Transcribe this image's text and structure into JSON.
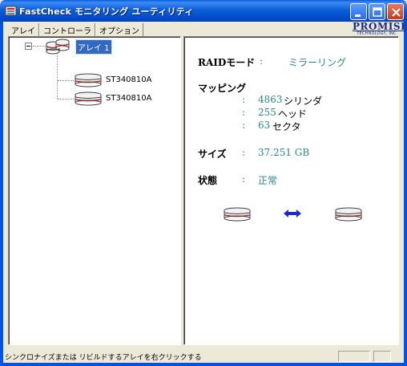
{
  "window": {
    "title": "FastCheck モニタリング ユーティリティ"
  },
  "tabs": [
    {
      "label": "アレイ"
    },
    {
      "label": "コントローラ"
    },
    {
      "label": "オプション"
    }
  ],
  "logo": {
    "brand": "PROMISE",
    "subtitle": "TECHNOLOGY, INC"
  },
  "tree": {
    "array_label": "アレイ 1",
    "disks": [
      {
        "label": "ST340810A"
      },
      {
        "label": "ST340810A"
      }
    ]
  },
  "details": {
    "raid_mode_label": "RAIDモード",
    "raid_mode_value": "ミラーリング",
    "mapping_label": "マッピング",
    "cylinders_value": "4863",
    "cylinders_unit": "シリンダ",
    "heads_value": "255",
    "heads_unit": "ヘッド",
    "sectors_value": "63",
    "sectors_unit": "セクタ",
    "size_label": "サイズ",
    "size_value": "37.251 GB",
    "status_label": "状態",
    "status_value": "正常",
    "colon": ":"
  },
  "statusbar": {
    "text": "シンクロナイズまたは リビルドするアレイを右クリックする"
  },
  "colors": {
    "title_bar": "#0a5fd8",
    "selection": "#316ac5",
    "value_teal": "#2a8a8a",
    "mirror_arrow": "#1a2ad0"
  }
}
